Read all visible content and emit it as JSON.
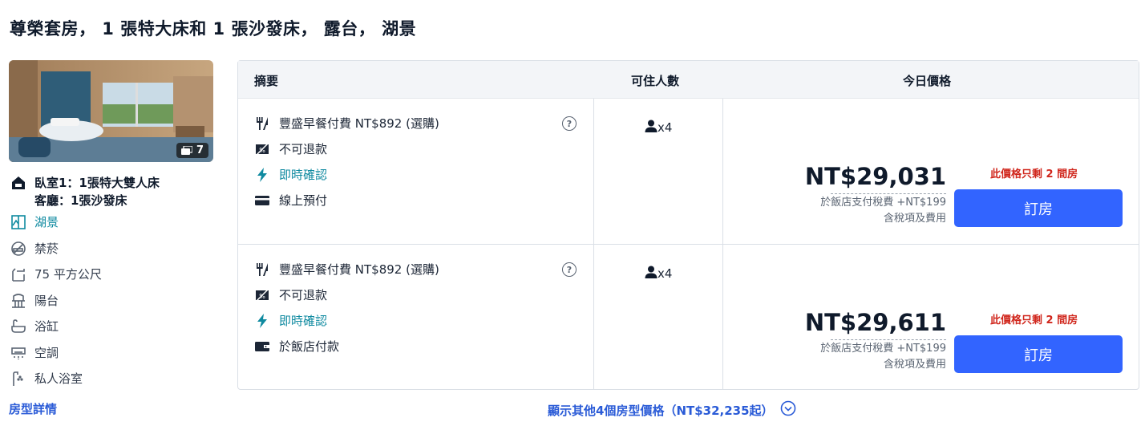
{
  "room_title": "尊榮套房， 1 張特大床和 1 張沙發床， 露台， 湖景",
  "photo": {
    "count": "7"
  },
  "room_features": {
    "bed_line1": "臥室1：1張特大雙人床",
    "bed_line2": "客廳：1張沙發床",
    "view": "湖景",
    "smoking": "禁菸",
    "size": "75 平方公尺",
    "balcony": "陽台",
    "bathtub": "浴缸",
    "aircon": "空調",
    "bathroom": "私人浴室"
  },
  "room_details_link": "房型詳情",
  "table": {
    "headers": {
      "summary": "摘要",
      "guests": "可住人數",
      "price": "今日價格"
    },
    "rows": [
      {
        "breakfast": "豐盛早餐付費 NT$892 (選購)",
        "refund": "不可退款",
        "instant": "即時確認",
        "payment": "線上預付",
        "guests": "x4",
        "price": "NT$29,031",
        "tax_line": "於飯店支付稅費 +NT$199",
        "incl_line": "含稅項及費用",
        "scarcity": "此價格只剩 2 間房",
        "book_label": "訂房",
        "help": "?"
      },
      {
        "breakfast": "豐盛早餐付費 NT$892 (選購)",
        "refund": "不可退款",
        "instant": "即時確認",
        "payment": "於飯店付款",
        "guests": "x4",
        "price": "NT$29,611",
        "tax_line": "於飯店支付稅費 +NT$199",
        "incl_line": "含稅項及費用",
        "scarcity": "此價格只剩 2 間房",
        "book_label": "訂房",
        "help": "?"
      }
    ]
  },
  "show_more": "顯示其他4個房型價格（NT$32,235起）",
  "colors": {
    "accent_blue": "#3264ff",
    "link_blue": "#2a5bd7",
    "teal": "#0f8aa0",
    "alert_red": "#d0261c"
  }
}
